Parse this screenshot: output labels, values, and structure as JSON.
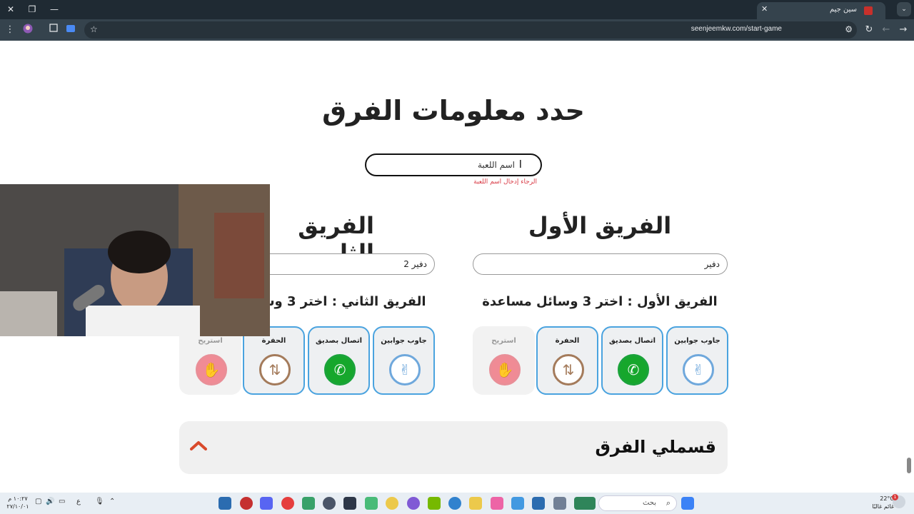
{
  "browser": {
    "tab_title": "سين جيم",
    "url": "seenjeemkw.com/start-game",
    "close_tab_glyph": "✕",
    "new_tab_glyph": "+",
    "tab_menu_glyph": "⌄",
    "minimize_glyph": "—",
    "restore_glyph": "❐",
    "close_glyph": "✕"
  },
  "page": {
    "title": "حدد معلومات الفرق",
    "game_name_value": "اسم اللعبة",
    "game_name_error": "الرجاء إدخال اسم اللعبة",
    "team1": {
      "title": "الفريق الأول",
      "name_value": "دفير",
      "help_title": "الفريق الأول : اختر 3 وسائل مساعدة",
      "aids": [
        {
          "label": "جاوب جوابين",
          "icon": "peace-hand-icon",
          "selected": true
        },
        {
          "label": "اتصال بصديق",
          "icon": "phone-icon",
          "selected": true
        },
        {
          "label": "الحفرة",
          "icon": "pit-arrows-icon",
          "selected": true
        },
        {
          "label": "استريح",
          "icon": "stop-hand-icon",
          "selected": false
        }
      ]
    },
    "team2": {
      "title": "الفريق الثا",
      "name_value": "دفير 2",
      "help_title": "الفريق الثاني : اختر 3 وسائل مساعدة",
      "aids": [
        {
          "label": "جاوب جوابين",
          "icon": "peace-hand-icon",
          "selected": true
        },
        {
          "label": "اتصال بصديق",
          "icon": "phone-icon",
          "selected": true
        },
        {
          "label": "الحفرة",
          "icon": "pit-arrows-icon",
          "selected": true
        },
        {
          "label": "استريح",
          "icon": "stop-hand-icon",
          "selected": false
        }
      ]
    },
    "split_teams_title": "قسملي الفرق"
  },
  "taskbar": {
    "search_placeholder": "بحث",
    "weather_temp": "22°C",
    "weather_desc": "غائم غالبًا",
    "weather_badge": "1",
    "clock_time": "١٠:٢٧ م",
    "clock_date": "٢٧/١٠/٠١",
    "lang": "ع"
  },
  "colors": {
    "accent_border": "#4aa3df",
    "error": "#d93a45",
    "chevron": "#d94a2b"
  }
}
